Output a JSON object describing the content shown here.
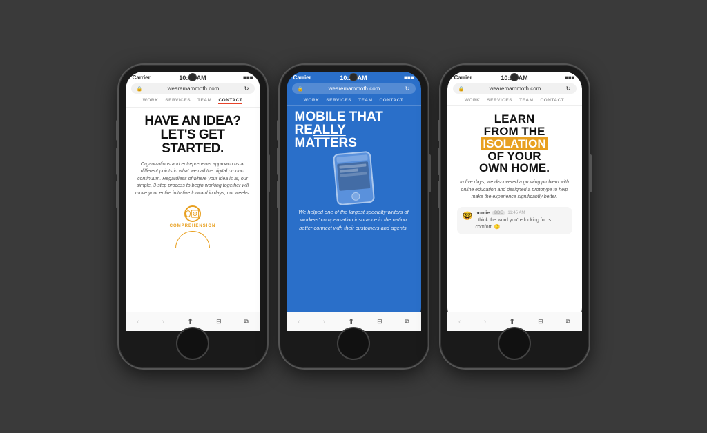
{
  "phones": [
    {
      "id": "phone1",
      "statusBar": {
        "carrier": "Carrier",
        "time": "10:08 AM",
        "battery": "■■■"
      },
      "urlBar": {
        "lock": "🔒",
        "url": "wearemammoth.com",
        "refresh": "↻"
      },
      "nav": {
        "items": [
          "WORK",
          "SERVICES",
          "TEAM",
          "CONTACT"
        ],
        "active": "CONTACT"
      },
      "bgColor": "white",
      "heading": "HAVE AN IDEA? LET'S GET STARTED.",
      "bodyText": "Organizations and entrepreneurs approach us at different points in what we call the digital product continuum. Regardless of where your idea is at, our simple, 3-step process to begin working together will move your entire initiative forward in days, not weeks.",
      "bottomLabel": "COMPREHENSION"
    },
    {
      "id": "phone2",
      "statusBar": {
        "carrier": "Carrier",
        "time": "10:14 AM",
        "battery": "■■■"
      },
      "urlBar": {
        "lock": "🔒",
        "url": "wearemammoth.com",
        "refresh": "↻"
      },
      "nav": {
        "items": [
          "WORK",
          "SERVICES",
          "TEAM",
          "CONTACT"
        ],
        "active": ""
      },
      "bgColor": "blue",
      "heading_line1": "MOBILE THAT",
      "heading_line2_pre": "RE",
      "heading_line2_highlight": "ALLY",
      "heading_line2_post": "",
      "heading_line3": "MATTERS",
      "bodyText": "We helped one of the largest specialty writers of workers' compensation insurance in the nation better connect with their customers and agents."
    },
    {
      "id": "phone3",
      "statusBar": {
        "carrier": "Carrier",
        "time": "10:14 AM",
        "battery": "■■■"
      },
      "urlBar": {
        "lock": "🔒",
        "url": "wearemammoth.com",
        "refresh": "↻"
      },
      "nav": {
        "items": [
          "WORK",
          "SERVICES",
          "TEAM",
          "CONTACT"
        ],
        "active": ""
      },
      "bgColor": "white",
      "heading_line1": "LEARN",
      "heading_line2": "FROM THE",
      "heading_line3_pre": "",
      "heading_line3_highlight": "ISOLATION",
      "heading_line4": "OF YOUR",
      "heading_line5": "OWN HOME.",
      "bodyText": "In five days, we discovered a growing problem with online education and designed a prototype to help make the experience significantly better.",
      "chat": {
        "avatar": "🤓",
        "name": "homie",
        "tag": "BDE",
        "time": "11:45 AM",
        "message": "I think the word you're looking for is comfort. 🙂"
      }
    }
  ],
  "toolbar": {
    "back": "‹",
    "forward": "›",
    "share": "⬆",
    "bookmarks": "□□",
    "tabs": "⧉"
  }
}
